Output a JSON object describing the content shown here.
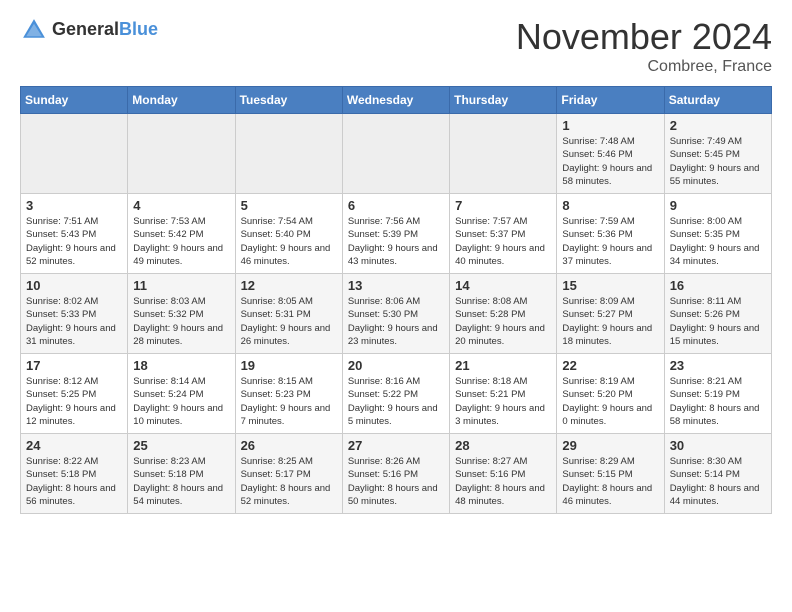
{
  "header": {
    "logo_general": "General",
    "logo_blue": "Blue",
    "month_title": "November 2024",
    "location": "Combree, France"
  },
  "days_of_week": [
    "Sunday",
    "Monday",
    "Tuesday",
    "Wednesday",
    "Thursday",
    "Friday",
    "Saturday"
  ],
  "weeks": [
    [
      {
        "day": "",
        "detail": ""
      },
      {
        "day": "",
        "detail": ""
      },
      {
        "day": "",
        "detail": ""
      },
      {
        "day": "",
        "detail": ""
      },
      {
        "day": "",
        "detail": ""
      },
      {
        "day": "1",
        "detail": "Sunrise: 7:48 AM\nSunset: 5:46 PM\nDaylight: 9 hours and 58 minutes."
      },
      {
        "day": "2",
        "detail": "Sunrise: 7:49 AM\nSunset: 5:45 PM\nDaylight: 9 hours and 55 minutes."
      }
    ],
    [
      {
        "day": "3",
        "detail": "Sunrise: 7:51 AM\nSunset: 5:43 PM\nDaylight: 9 hours and 52 minutes."
      },
      {
        "day": "4",
        "detail": "Sunrise: 7:53 AM\nSunset: 5:42 PM\nDaylight: 9 hours and 49 minutes."
      },
      {
        "day": "5",
        "detail": "Sunrise: 7:54 AM\nSunset: 5:40 PM\nDaylight: 9 hours and 46 minutes."
      },
      {
        "day": "6",
        "detail": "Sunrise: 7:56 AM\nSunset: 5:39 PM\nDaylight: 9 hours and 43 minutes."
      },
      {
        "day": "7",
        "detail": "Sunrise: 7:57 AM\nSunset: 5:37 PM\nDaylight: 9 hours and 40 minutes."
      },
      {
        "day": "8",
        "detail": "Sunrise: 7:59 AM\nSunset: 5:36 PM\nDaylight: 9 hours and 37 minutes."
      },
      {
        "day": "9",
        "detail": "Sunrise: 8:00 AM\nSunset: 5:35 PM\nDaylight: 9 hours and 34 minutes."
      }
    ],
    [
      {
        "day": "10",
        "detail": "Sunrise: 8:02 AM\nSunset: 5:33 PM\nDaylight: 9 hours and 31 minutes."
      },
      {
        "day": "11",
        "detail": "Sunrise: 8:03 AM\nSunset: 5:32 PM\nDaylight: 9 hours and 28 minutes."
      },
      {
        "day": "12",
        "detail": "Sunrise: 8:05 AM\nSunset: 5:31 PM\nDaylight: 9 hours and 26 minutes."
      },
      {
        "day": "13",
        "detail": "Sunrise: 8:06 AM\nSunset: 5:30 PM\nDaylight: 9 hours and 23 minutes."
      },
      {
        "day": "14",
        "detail": "Sunrise: 8:08 AM\nSunset: 5:28 PM\nDaylight: 9 hours and 20 minutes."
      },
      {
        "day": "15",
        "detail": "Sunrise: 8:09 AM\nSunset: 5:27 PM\nDaylight: 9 hours and 18 minutes."
      },
      {
        "day": "16",
        "detail": "Sunrise: 8:11 AM\nSunset: 5:26 PM\nDaylight: 9 hours and 15 minutes."
      }
    ],
    [
      {
        "day": "17",
        "detail": "Sunrise: 8:12 AM\nSunset: 5:25 PM\nDaylight: 9 hours and 12 minutes."
      },
      {
        "day": "18",
        "detail": "Sunrise: 8:14 AM\nSunset: 5:24 PM\nDaylight: 9 hours and 10 minutes."
      },
      {
        "day": "19",
        "detail": "Sunrise: 8:15 AM\nSunset: 5:23 PM\nDaylight: 9 hours and 7 minutes."
      },
      {
        "day": "20",
        "detail": "Sunrise: 8:16 AM\nSunset: 5:22 PM\nDaylight: 9 hours and 5 minutes."
      },
      {
        "day": "21",
        "detail": "Sunrise: 8:18 AM\nSunset: 5:21 PM\nDaylight: 9 hours and 3 minutes."
      },
      {
        "day": "22",
        "detail": "Sunrise: 8:19 AM\nSunset: 5:20 PM\nDaylight: 9 hours and 0 minutes."
      },
      {
        "day": "23",
        "detail": "Sunrise: 8:21 AM\nSunset: 5:19 PM\nDaylight: 8 hours and 58 minutes."
      }
    ],
    [
      {
        "day": "24",
        "detail": "Sunrise: 8:22 AM\nSunset: 5:18 PM\nDaylight: 8 hours and 56 minutes."
      },
      {
        "day": "25",
        "detail": "Sunrise: 8:23 AM\nSunset: 5:18 PM\nDaylight: 8 hours and 54 minutes."
      },
      {
        "day": "26",
        "detail": "Sunrise: 8:25 AM\nSunset: 5:17 PM\nDaylight: 8 hours and 52 minutes."
      },
      {
        "day": "27",
        "detail": "Sunrise: 8:26 AM\nSunset: 5:16 PM\nDaylight: 8 hours and 50 minutes."
      },
      {
        "day": "28",
        "detail": "Sunrise: 8:27 AM\nSunset: 5:16 PM\nDaylight: 8 hours and 48 minutes."
      },
      {
        "day": "29",
        "detail": "Sunrise: 8:29 AM\nSunset: 5:15 PM\nDaylight: 8 hours and 46 minutes."
      },
      {
        "day": "30",
        "detail": "Sunrise: 8:30 AM\nSunset: 5:14 PM\nDaylight: 8 hours and 44 minutes."
      }
    ]
  ]
}
